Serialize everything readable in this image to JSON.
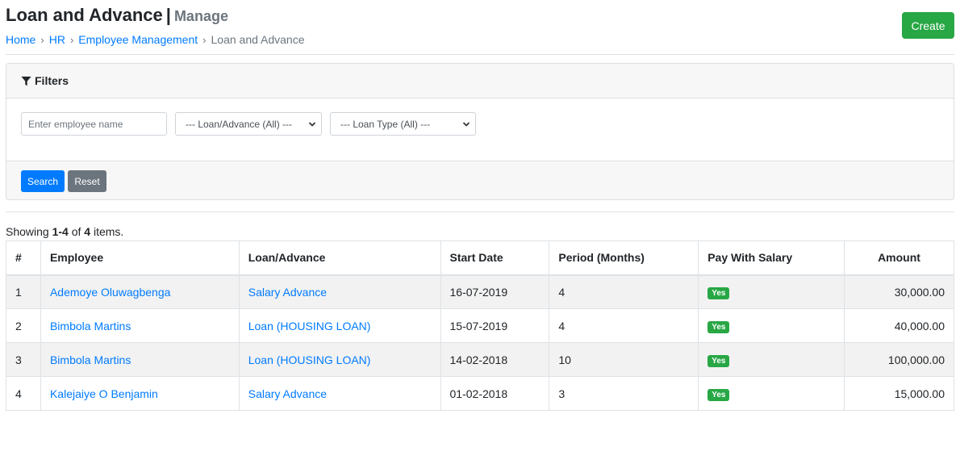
{
  "header": {
    "title": "Loan and Advance",
    "separator": "|",
    "subtitle": "Manage",
    "create_label": "Create"
  },
  "breadcrumb": {
    "items": [
      "Home",
      "HR",
      "Employee Management"
    ],
    "active": "Loan and Advance",
    "separator": "›"
  },
  "filters": {
    "title": "Filters",
    "name_placeholder": "Enter employee name",
    "loan_advance_selected": "--- Loan/Advance (All) ---",
    "loan_type_selected": "--- Loan Type (All) ---",
    "search_label": "Search",
    "reset_label": "Reset"
  },
  "summary": {
    "prefix": "Showing ",
    "range": "1-4",
    "of": " of ",
    "total": "4",
    "suffix": " items."
  },
  "table": {
    "columns": [
      "#",
      "Employee",
      "Loan/Advance",
      "Start Date",
      "Period (Months)",
      "Pay With Salary",
      "Amount"
    ],
    "rows": [
      {
        "index": "1",
        "employee": "Ademoye Oluwagbenga",
        "loan_advance": "Salary Advance",
        "start_date": "16-07-2019",
        "period": "4",
        "pay_with_salary": "Yes",
        "amount": "30,000.00"
      },
      {
        "index": "2",
        "employee": "Bimbola Martins",
        "loan_advance": "Loan (HOUSING LOAN)",
        "start_date": "15-07-2019",
        "period": "4",
        "pay_with_salary": "Yes",
        "amount": "40,000.00"
      },
      {
        "index": "3",
        "employee": "Bimbola Martins",
        "loan_advance": "Loan (HOUSING LOAN)",
        "start_date": "14-02-2018",
        "period": "10",
        "pay_with_salary": "Yes",
        "amount": "100,000.00"
      },
      {
        "index": "4",
        "employee": "Kalejaiye O Benjamin",
        "loan_advance": "Salary Advance",
        "start_date": "01-02-2018",
        "period": "3",
        "pay_with_salary": "Yes",
        "amount": "15,000.00"
      }
    ]
  },
  "colors": {
    "primary": "#007bff",
    "success": "#28a745",
    "secondary": "#6c757d"
  },
  "icons": {
    "filter": "filter-icon",
    "dropdown": "chevron-down-icon"
  }
}
